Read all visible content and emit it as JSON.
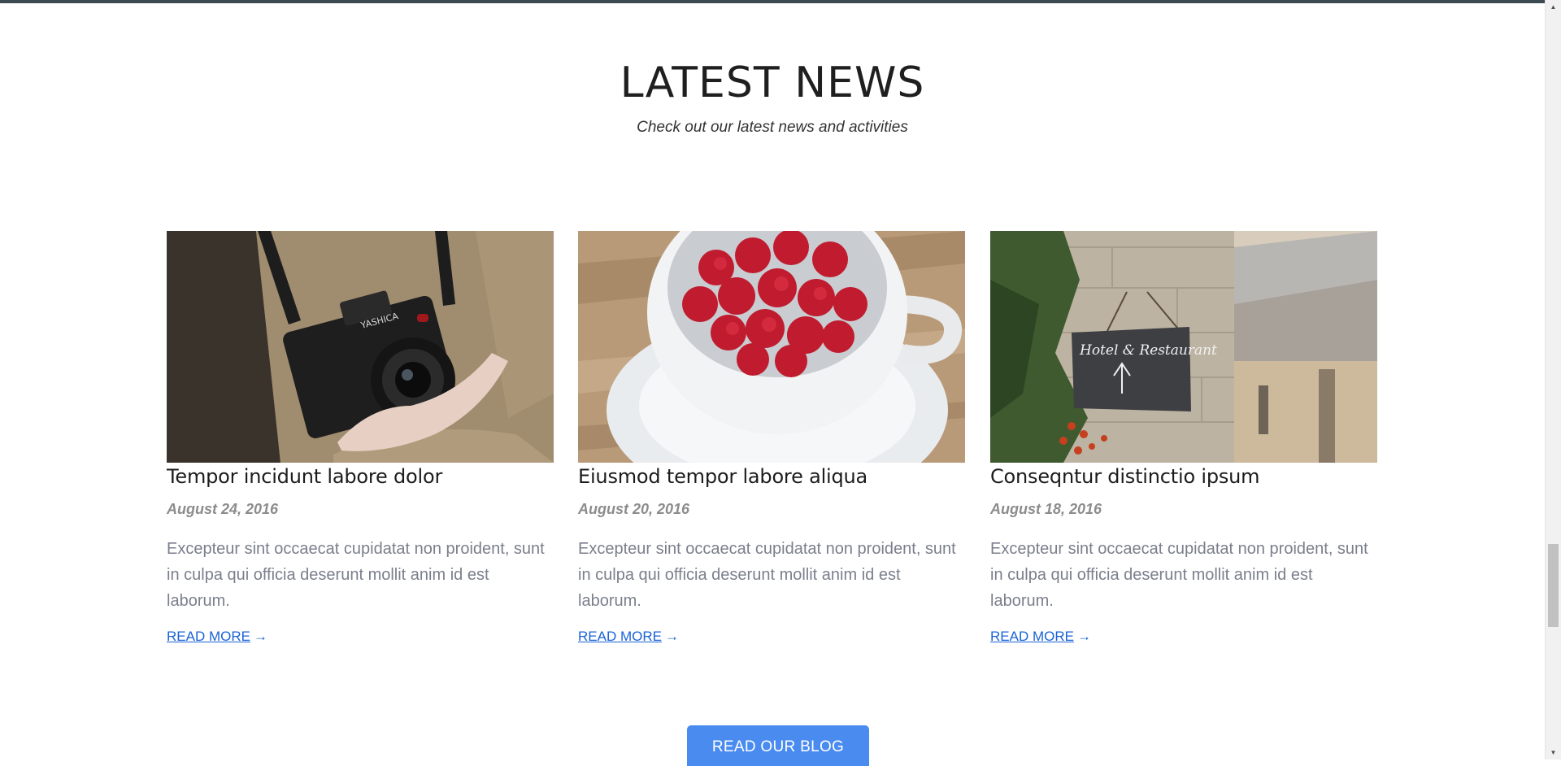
{
  "section": {
    "title": "LATEST NEWS",
    "subtitle": "Check out our latest news and activities"
  },
  "posts": [
    {
      "title": "Tempor incidunt labore dolor",
      "date": "August 24, 2016",
      "excerpt": "Excepteur sint occaecat cupidatat non proident, sunt in culpa qui officia deserunt mollit anim id est laborum.",
      "link_label": "READ MORE",
      "link_icon": "arrow-right-icon",
      "image": "camera-photo"
    },
    {
      "title": "Eiusmod tempor labore aliqua",
      "date": "August 20, 2016",
      "excerpt": "Excepteur sint occaecat cupidatat non proident, sunt in culpa qui officia deserunt mollit anim id est laborum.",
      "link_label": "READ MORE",
      "link_icon": "arrow-right-icon",
      "image": "raspberries-cup-photo"
    },
    {
      "title": "Conseqntur distinctio ipsum",
      "date": "August 18, 2016",
      "excerpt": "Excepteur sint occaecat cupidatat non proident, sunt in culpa qui officia deserunt mollit anim id est laborum.",
      "link_label": "READ MORE",
      "link_icon": "arrow-right-icon",
      "image": "hotel-sign-photo",
      "sign_text": "Hotel & Restaurant"
    }
  ],
  "blog_button": {
    "label": "READ OUR BLOG"
  },
  "colors": {
    "accent": "#4a8bf0",
    "link": "#1a63d6",
    "date": "#8c8c8c",
    "excerpt": "#7b7f8c",
    "topbar": "#3c4a52"
  }
}
